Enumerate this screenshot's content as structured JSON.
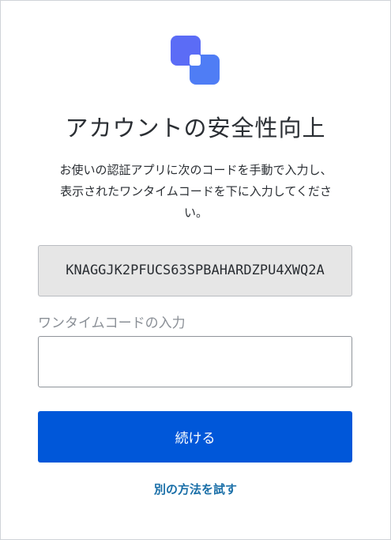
{
  "brand": {
    "logo_icon": "overlapping-squares-logo-icon",
    "logo_color_primary": "#5b6cf6",
    "logo_color_secondary": "#4f7df5"
  },
  "page": {
    "title": "アカウントの安全性向上",
    "description_lines": [
      "お使いの認証アプリに次のコードを手動で入力し、",
      "表示されたワンタイムコードを下に入力してくださ",
      "い。"
    ]
  },
  "secret": {
    "code": "KNAGGJK2PFUCS63SPBAHARDZPU4XWQ2A"
  },
  "otp": {
    "label": "ワンタイムコードの入力",
    "value": "",
    "placeholder": ""
  },
  "actions": {
    "continue_label": "続ける",
    "continue_color": "#0057d9",
    "alternate_label": "別の方法を試す",
    "alternate_color": "#1a6fa8"
  }
}
